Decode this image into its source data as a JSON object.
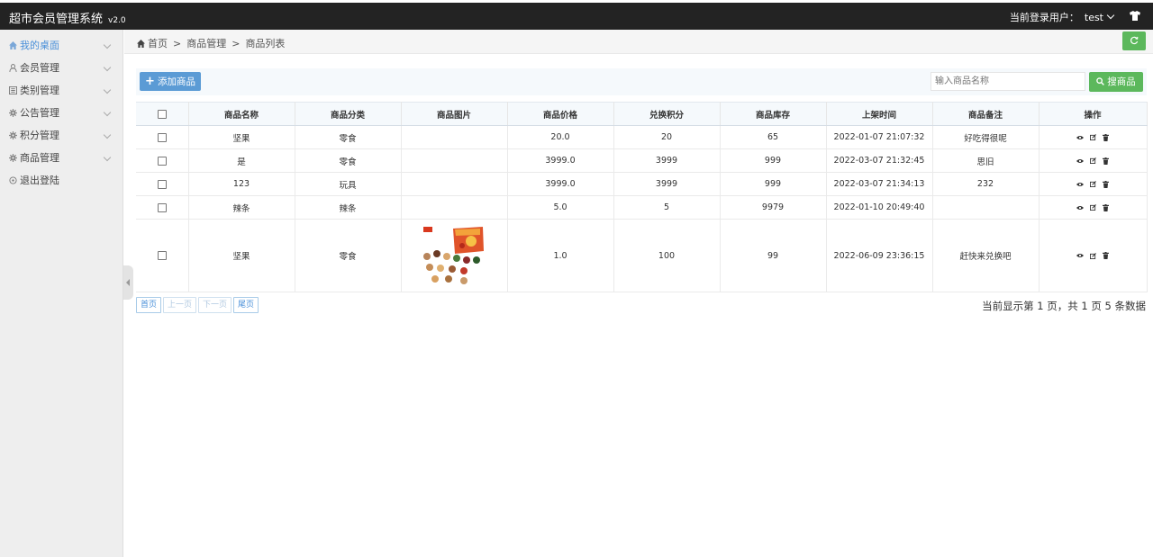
{
  "app": {
    "title": "超市会员管理系统",
    "version": "v2.0"
  },
  "header": {
    "login_label": "当前登录用户：",
    "username": "test"
  },
  "sidebar": {
    "items": [
      {
        "label": "我的桌面",
        "icon": "home-icon",
        "active": true
      },
      {
        "label": "会员管理",
        "icon": "user-icon"
      },
      {
        "label": "类别管理",
        "icon": "list-icon"
      },
      {
        "label": "公告管理",
        "icon": "gear-icon"
      },
      {
        "label": "积分管理",
        "icon": "gear-icon"
      },
      {
        "label": "商品管理",
        "icon": "gear-icon"
      },
      {
        "label": "退出登陆",
        "icon": "logout-icon"
      }
    ]
  },
  "breadcrumb": {
    "items": [
      "首页",
      "商品管理",
      "商品列表"
    ],
    "separator": ">"
  },
  "toolbar": {
    "add_label": "添加商品",
    "search_placeholder": "输入商品名称",
    "search_label": "搜商品"
  },
  "table": {
    "columns": [
      "商品名称",
      "商品分类",
      "商品图片",
      "商品价格",
      "兑换积分",
      "商品库存",
      "上架时间",
      "商品备注",
      "操作"
    ],
    "rows": [
      {
        "name": "坚果",
        "category": "零食",
        "image": false,
        "price": "20.0",
        "points": "20",
        "stock": "65",
        "time": "2022-01-07 21:07:32",
        "note": "好吃得很呢"
      },
      {
        "name": "是",
        "category": "零食",
        "image": false,
        "price": "3999.0",
        "points": "3999",
        "stock": "999",
        "time": "2022-03-07 21:32:45",
        "note": "思旧"
      },
      {
        "name": "123",
        "category": "玩具",
        "image": false,
        "price": "3999.0",
        "points": "3999",
        "stock": "999",
        "time": "2022-03-07 21:34:13",
        "note": "232"
      },
      {
        "name": "辣条",
        "category": "辣条",
        "image": false,
        "price": "5.0",
        "points": "5",
        "stock": "9979",
        "time": "2022-01-10 20:49:40",
        "note": ""
      },
      {
        "name": "坚果",
        "category": "零食",
        "image": true,
        "price": "1.0",
        "points": "100",
        "stock": "99",
        "time": "2022-06-09 23:36:15",
        "note": "赶快来兑换吧"
      }
    ]
  },
  "pager": {
    "first": "首页",
    "prev": "上一页",
    "next": "下一页",
    "last": "尾页",
    "info": "当前显示第 1 页，共 1 页 5 条数据"
  },
  "colors": {
    "topbar": "#232323",
    "primary": "#5b9bd5",
    "success": "#5cb85c",
    "active": "#4a90d9"
  }
}
